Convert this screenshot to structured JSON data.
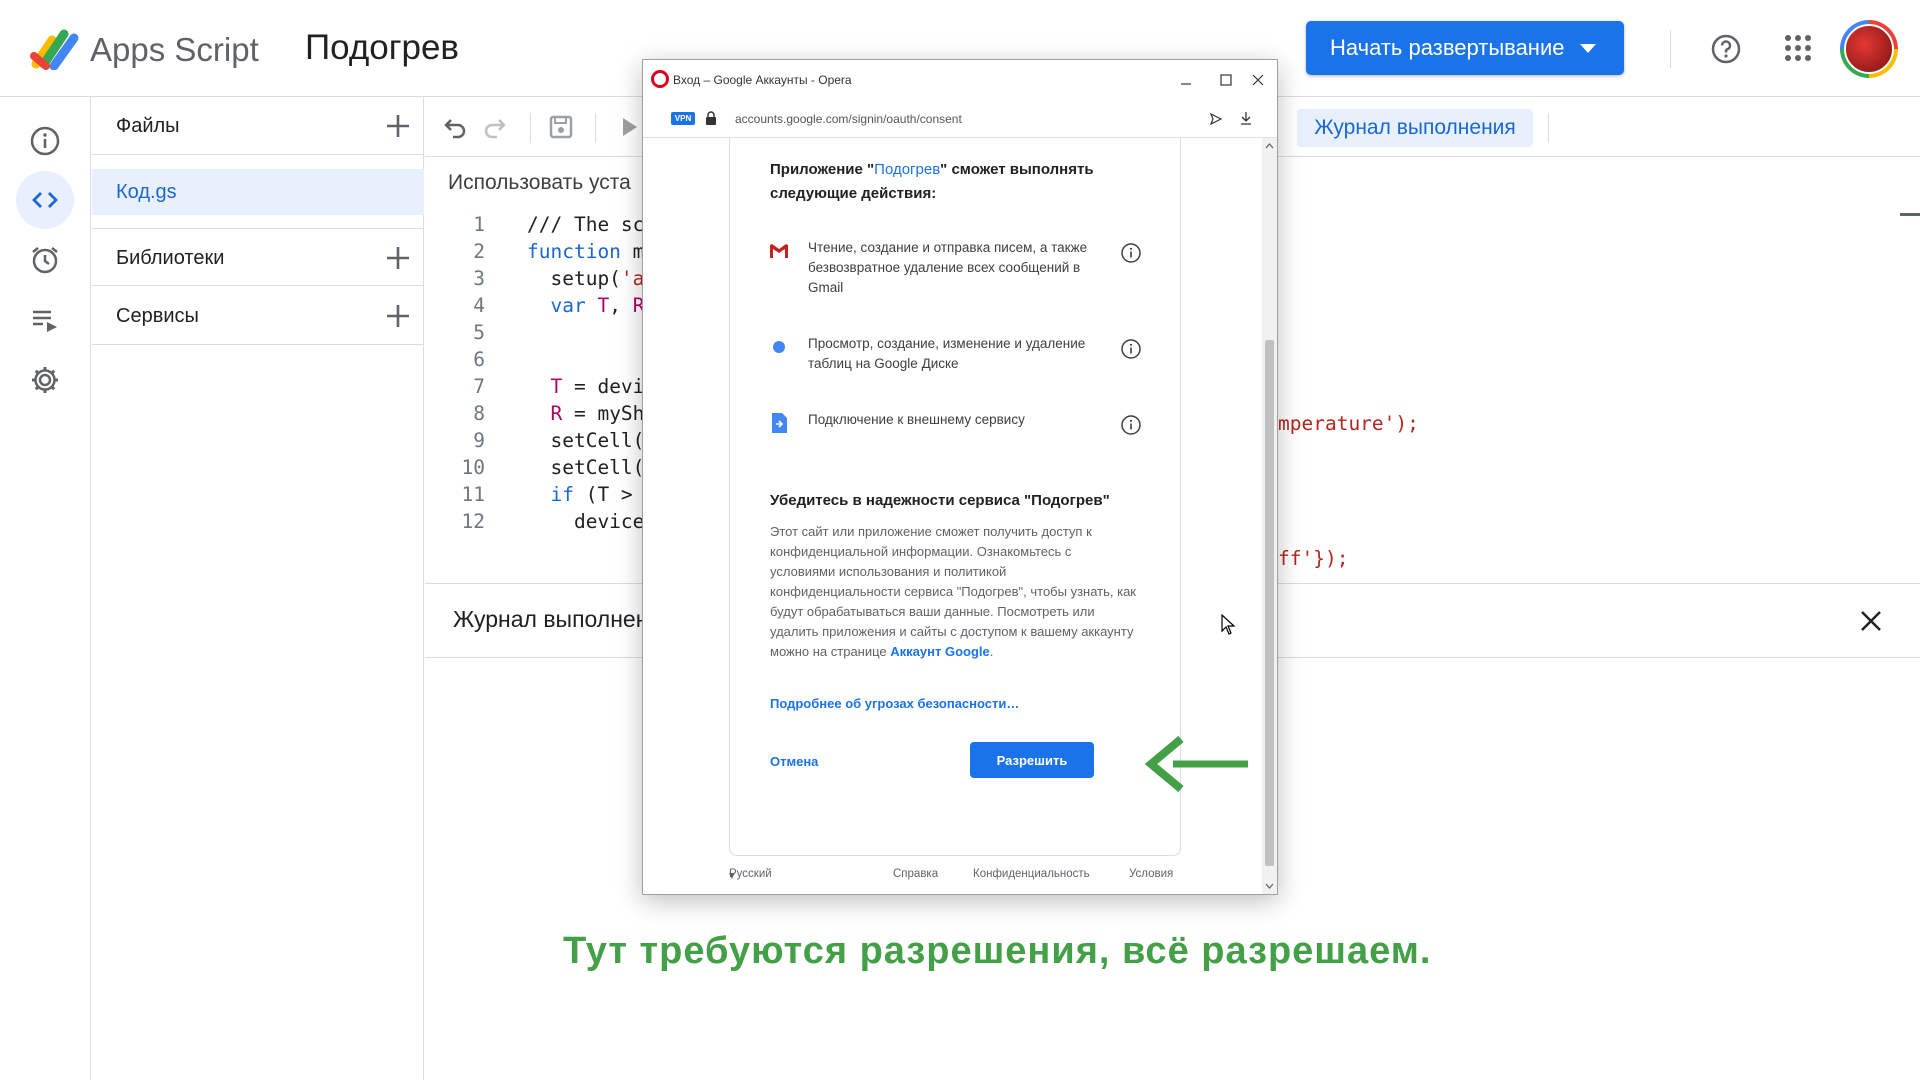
{
  "header": {
    "brand": "Apps Script",
    "project_name": "Подогрев",
    "deploy_label": "Начать развертывание",
    "icons": [
      "help-icon",
      "apps-grid-icon",
      "avatar"
    ]
  },
  "rail": {
    "items": [
      "info-icon",
      "code-icon",
      "alarm-clock-icon",
      "executions-icon",
      "gear-icon"
    ]
  },
  "files_panel": {
    "files_title": "Файлы",
    "file_name": "Код.gs",
    "libraries_title": "Библиотеки",
    "services_title": "Сервисы"
  },
  "toolbar": {
    "exec_log_label": "Журнал выполнения",
    "install_text": "Использовать уста"
  },
  "code": {
    "lines": [
      {
        "n": "1",
        "t": "/// The sc"
      },
      {
        "n": "2",
        "t": "function m"
      },
      {
        "n": "3",
        "t": "  setup('a"
      },
      {
        "n": "4",
        "t": "  var T, R"
      },
      {
        "n": "5",
        "t": ""
      },
      {
        "n": "6",
        "t": ""
      },
      {
        "n": "7",
        "t": "  T = devi"
      },
      {
        "n": "8",
        "t": "  R = mySh"
      },
      {
        "n": "9",
        "t": "  setCell("
      },
      {
        "n": "10",
        "t": "  setCell("
      },
      {
        "n": "11",
        "t": "  if (T >"
      },
      {
        "n": "12",
        "t": "    device"
      }
    ],
    "right_fragment_1": "mperature');",
    "right_fragment_2": "ff'});"
  },
  "log_panel": {
    "title": "Журнал выполнения"
  },
  "caption": "Тут требуются разрешения, всё разрешаем.",
  "popup": {
    "window_title": "Вход – Google Аккаунты - Opera",
    "vpn_label": "VPN",
    "url": "accounts.google.com/signin/oauth/consent",
    "header_prefix": "Приложение \"",
    "app_name": "Подогрев",
    "header_suffix": "\" сможет выполнять следующие действия:",
    "permissions": [
      {
        "icon": "gmail-icon",
        "text": "Чтение, создание и отправка писем, а также безвозвратное удаление всех сообщений в Gmail"
      },
      {
        "icon": "sheets-icon",
        "text": "Просмотр, создание, изменение и удаление таблиц на Google Диске"
      },
      {
        "icon": "external-service-icon",
        "text": "Подключение к внешнему сервису"
      }
    ],
    "security_title": "Убедитесь в надежности сервиса \"Подогрев\"",
    "security_text": "Этот сайт или приложение сможет получить доступ к конфиденциальной информации. Ознакомьтесь с условиями использования и политикой конфиденциальности сервиса \"Подогрев\", чтобы узнать, как будут обрабатываться ваши данные. Посмотреть или удалить приложения и сайты с доступом к вашему аккаунту можно на странице ",
    "account_link": "Аккаунт Google",
    "security_end": ".",
    "more_link": "Подробнее об угрозах безопасности…",
    "cancel_label": "Отмена",
    "allow_label": "Разрешить",
    "footer": {
      "language": "Русский",
      "help": "Справка",
      "privacy": "Конфиденциальность",
      "terms": "Условия"
    }
  },
  "colors": {
    "accent": "#1a73e8",
    "caption_green": "#43a047"
  }
}
